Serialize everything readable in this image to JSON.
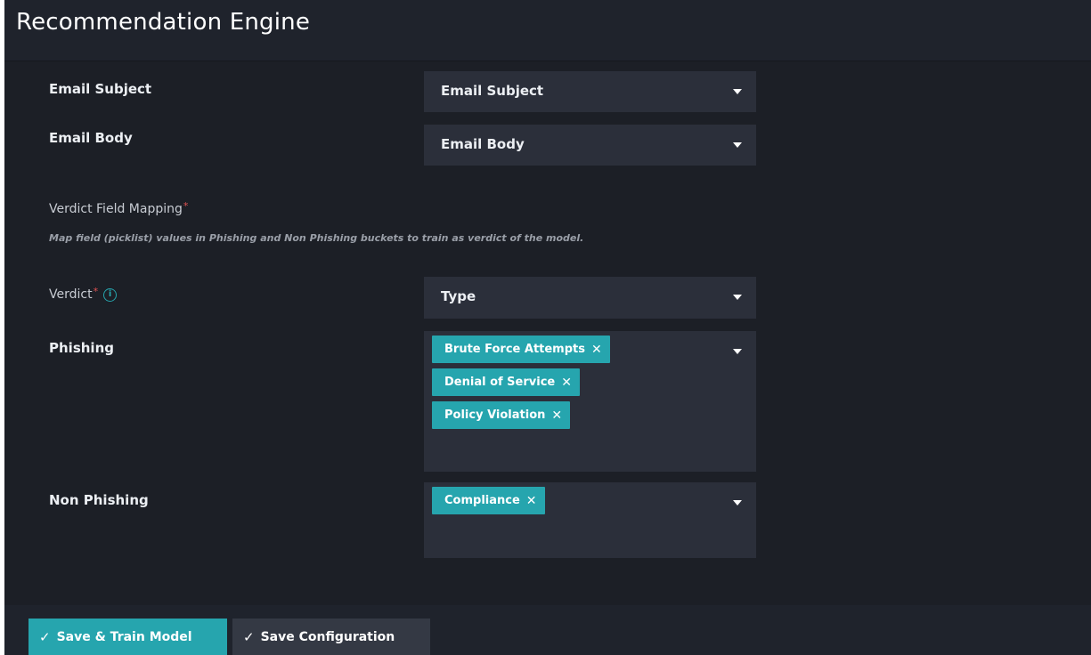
{
  "header": {
    "title": "Recommendation Engine"
  },
  "fields": {
    "email_subject": {
      "label": "Email Subject",
      "value": "Email Subject"
    },
    "email_body": {
      "label": "Email Body",
      "value": "Email Body"
    }
  },
  "verdict_mapping": {
    "title": "Verdict Field Mapping",
    "required_mark": "*",
    "description": "Map field (picklist) values in Phishing and Non Phishing buckets to train as verdict of the model."
  },
  "verdict": {
    "label": "Verdict",
    "required_mark": "*",
    "info_icon": "i",
    "value": "Type"
  },
  "phishing": {
    "label": "Phishing",
    "tags": [
      "Brute Force Attempts",
      "Denial of Service",
      "Policy Violation"
    ]
  },
  "non_phishing": {
    "label": "Non Phishing",
    "tags": [
      "Compliance"
    ]
  },
  "tag_remove_glyph": "✕",
  "footer": {
    "check_glyph": "✓",
    "save_train_label": "Save & Train Model",
    "save_config_label": "Save Configuration"
  },
  "colors": {
    "accent": "#26a5ae",
    "background": "#1c1f26",
    "field_background": "#2b2f3a",
    "required": "#e05252"
  }
}
